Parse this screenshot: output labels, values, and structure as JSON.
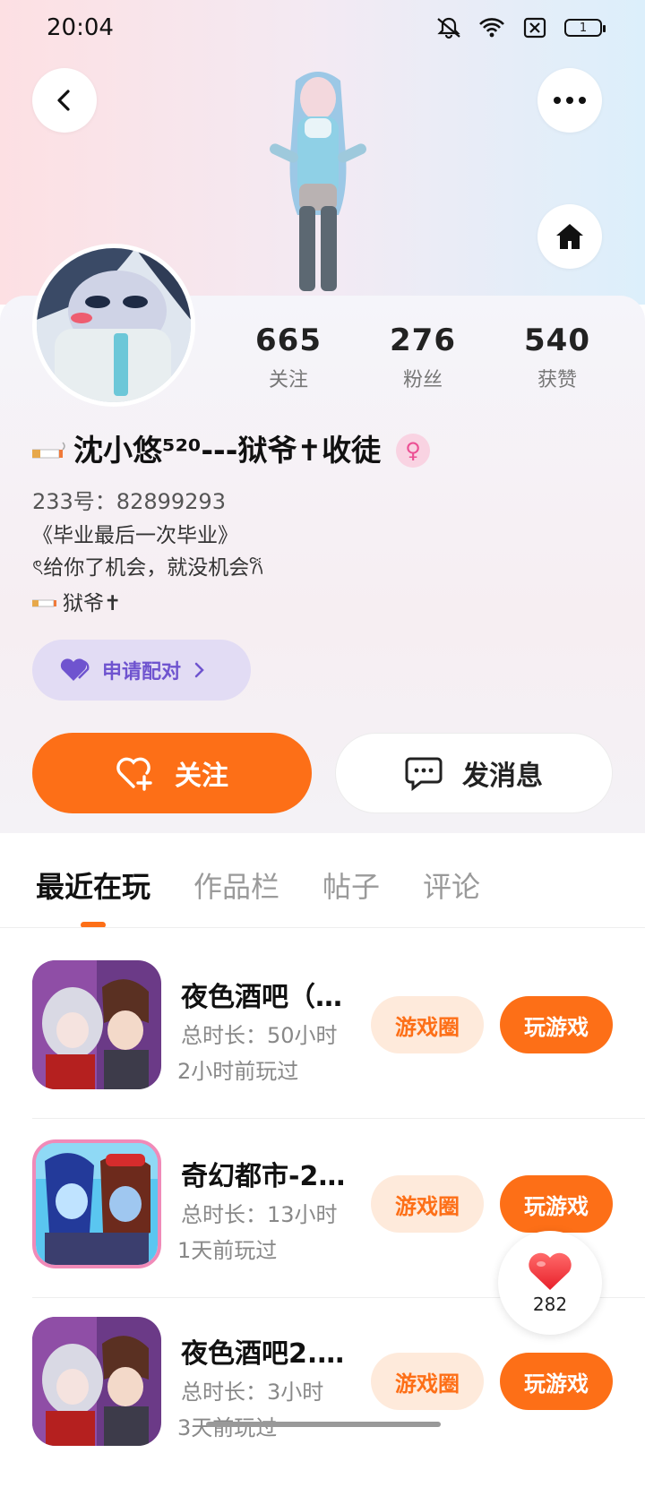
{
  "status_bar": {
    "time": "20:04",
    "battery": "1"
  },
  "profile": {
    "stats": [
      {
        "value": "665",
        "label": "关注"
      },
      {
        "value": "276",
        "label": "粉丝"
      },
      {
        "value": "540",
        "label": "获赞"
      }
    ],
    "username": "沈小悠⁵²⁰---狱爷✝收徒",
    "uid": "233号：82899293",
    "bio_lines": [
      "《毕业最后一次毕业》",
      "ৎ给你了机会，就没机会𐙚",
      "狱爷✝"
    ],
    "pair_label": "申请配对",
    "follow_label": "关注",
    "message_label": "发消息"
  },
  "tabs": [
    {
      "label": "最近在玩",
      "active": true
    },
    {
      "label": "作品栏",
      "active": false
    },
    {
      "label": "帖子",
      "active": false
    },
    {
      "label": "评论",
      "active": false
    }
  ],
  "games": [
    {
      "name": "夜色酒吧（…",
      "duration": "总时长：50小时",
      "last_played": "2小时前玩过",
      "circle_label": "游戏圈",
      "play_label": "玩游戏"
    },
    {
      "name": "奇幻都市-2…",
      "duration": "总时长：13小时",
      "last_played": "1天前玩过",
      "circle_label": "游戏圈",
      "play_label": "玩游戏"
    },
    {
      "name": "夜色酒吧2.…",
      "duration": "总时长：3小时",
      "last_played": "3天前玩过",
      "circle_label": "游戏圈",
      "play_label": "玩游戏"
    }
  ],
  "floating_like": {
    "count": "282"
  },
  "colors": {
    "accent": "#fd6f17",
    "accent_soft": "#feeadb",
    "pair_bg": "#e2dcf4",
    "pair_text": "#6f54cf"
  }
}
